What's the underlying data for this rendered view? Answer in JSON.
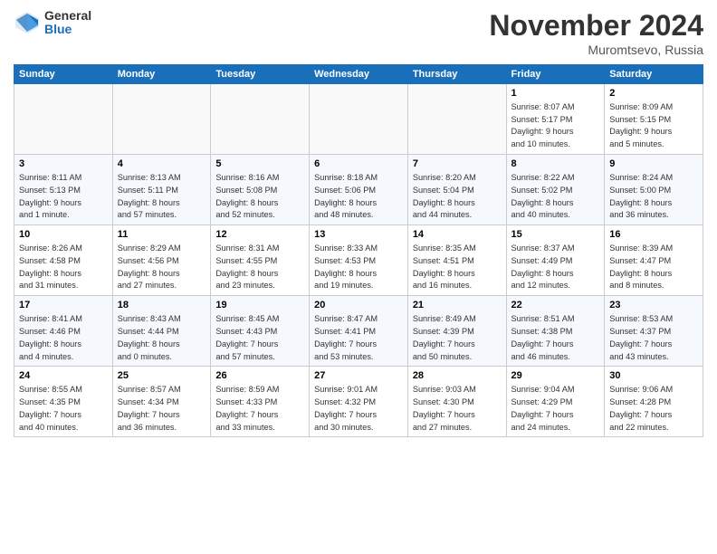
{
  "logo": {
    "general": "General",
    "blue": "Blue"
  },
  "title": "November 2024",
  "location": "Muromtsevo, Russia",
  "days_header": [
    "Sunday",
    "Monday",
    "Tuesday",
    "Wednesday",
    "Thursday",
    "Friday",
    "Saturday"
  ],
  "weeks": [
    [
      {
        "day": "",
        "info": ""
      },
      {
        "day": "",
        "info": ""
      },
      {
        "day": "",
        "info": ""
      },
      {
        "day": "",
        "info": ""
      },
      {
        "day": "",
        "info": ""
      },
      {
        "day": "1",
        "info": "Sunrise: 8:07 AM\nSunset: 5:17 PM\nDaylight: 9 hours\nand 10 minutes."
      },
      {
        "day": "2",
        "info": "Sunrise: 8:09 AM\nSunset: 5:15 PM\nDaylight: 9 hours\nand 5 minutes."
      }
    ],
    [
      {
        "day": "3",
        "info": "Sunrise: 8:11 AM\nSunset: 5:13 PM\nDaylight: 9 hours\nand 1 minute."
      },
      {
        "day": "4",
        "info": "Sunrise: 8:13 AM\nSunset: 5:11 PM\nDaylight: 8 hours\nand 57 minutes."
      },
      {
        "day": "5",
        "info": "Sunrise: 8:16 AM\nSunset: 5:08 PM\nDaylight: 8 hours\nand 52 minutes."
      },
      {
        "day": "6",
        "info": "Sunrise: 8:18 AM\nSunset: 5:06 PM\nDaylight: 8 hours\nand 48 minutes."
      },
      {
        "day": "7",
        "info": "Sunrise: 8:20 AM\nSunset: 5:04 PM\nDaylight: 8 hours\nand 44 minutes."
      },
      {
        "day": "8",
        "info": "Sunrise: 8:22 AM\nSunset: 5:02 PM\nDaylight: 8 hours\nand 40 minutes."
      },
      {
        "day": "9",
        "info": "Sunrise: 8:24 AM\nSunset: 5:00 PM\nDaylight: 8 hours\nand 36 minutes."
      }
    ],
    [
      {
        "day": "10",
        "info": "Sunrise: 8:26 AM\nSunset: 4:58 PM\nDaylight: 8 hours\nand 31 minutes."
      },
      {
        "day": "11",
        "info": "Sunrise: 8:29 AM\nSunset: 4:56 PM\nDaylight: 8 hours\nand 27 minutes."
      },
      {
        "day": "12",
        "info": "Sunrise: 8:31 AM\nSunset: 4:55 PM\nDaylight: 8 hours\nand 23 minutes."
      },
      {
        "day": "13",
        "info": "Sunrise: 8:33 AM\nSunset: 4:53 PM\nDaylight: 8 hours\nand 19 minutes."
      },
      {
        "day": "14",
        "info": "Sunrise: 8:35 AM\nSunset: 4:51 PM\nDaylight: 8 hours\nand 16 minutes."
      },
      {
        "day": "15",
        "info": "Sunrise: 8:37 AM\nSunset: 4:49 PM\nDaylight: 8 hours\nand 12 minutes."
      },
      {
        "day": "16",
        "info": "Sunrise: 8:39 AM\nSunset: 4:47 PM\nDaylight: 8 hours\nand 8 minutes."
      }
    ],
    [
      {
        "day": "17",
        "info": "Sunrise: 8:41 AM\nSunset: 4:46 PM\nDaylight: 8 hours\nand 4 minutes."
      },
      {
        "day": "18",
        "info": "Sunrise: 8:43 AM\nSunset: 4:44 PM\nDaylight: 8 hours\nand 0 minutes."
      },
      {
        "day": "19",
        "info": "Sunrise: 8:45 AM\nSunset: 4:43 PM\nDaylight: 7 hours\nand 57 minutes."
      },
      {
        "day": "20",
        "info": "Sunrise: 8:47 AM\nSunset: 4:41 PM\nDaylight: 7 hours\nand 53 minutes."
      },
      {
        "day": "21",
        "info": "Sunrise: 8:49 AM\nSunset: 4:39 PM\nDaylight: 7 hours\nand 50 minutes."
      },
      {
        "day": "22",
        "info": "Sunrise: 8:51 AM\nSunset: 4:38 PM\nDaylight: 7 hours\nand 46 minutes."
      },
      {
        "day": "23",
        "info": "Sunrise: 8:53 AM\nSunset: 4:37 PM\nDaylight: 7 hours\nand 43 minutes."
      }
    ],
    [
      {
        "day": "24",
        "info": "Sunrise: 8:55 AM\nSunset: 4:35 PM\nDaylight: 7 hours\nand 40 minutes."
      },
      {
        "day": "25",
        "info": "Sunrise: 8:57 AM\nSunset: 4:34 PM\nDaylight: 7 hours\nand 36 minutes."
      },
      {
        "day": "26",
        "info": "Sunrise: 8:59 AM\nSunset: 4:33 PM\nDaylight: 7 hours\nand 33 minutes."
      },
      {
        "day": "27",
        "info": "Sunrise: 9:01 AM\nSunset: 4:32 PM\nDaylight: 7 hours\nand 30 minutes."
      },
      {
        "day": "28",
        "info": "Sunrise: 9:03 AM\nSunset: 4:30 PM\nDaylight: 7 hours\nand 27 minutes."
      },
      {
        "day": "29",
        "info": "Sunrise: 9:04 AM\nSunset: 4:29 PM\nDaylight: 7 hours\nand 24 minutes."
      },
      {
        "day": "30",
        "info": "Sunrise: 9:06 AM\nSunset: 4:28 PM\nDaylight: 7 hours\nand 22 minutes."
      }
    ]
  ]
}
